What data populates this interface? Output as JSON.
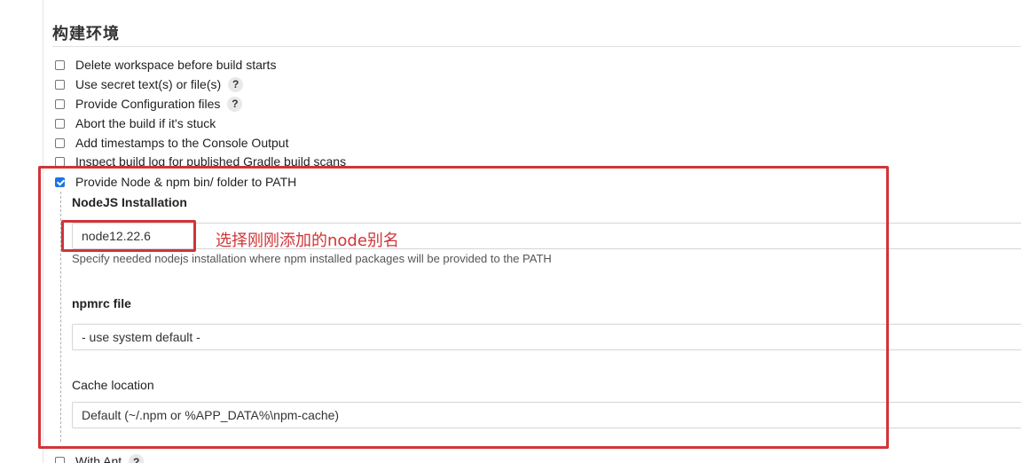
{
  "section": {
    "title": "构建环境"
  },
  "options": [
    {
      "label": "Delete workspace before build starts",
      "checked": false,
      "help": false
    },
    {
      "label": "Use secret text(s) or file(s)",
      "checked": false,
      "help": true
    },
    {
      "label": "Provide Configuration files",
      "checked": false,
      "help": true
    },
    {
      "label": "Abort the build if it's stuck",
      "checked": false,
      "help": false
    },
    {
      "label": "Add timestamps to the Console Output",
      "checked": false,
      "help": false
    },
    {
      "label": "Inspect build log for published Gradle build scans",
      "checked": false,
      "help": false
    },
    {
      "label": "Provide Node & npm bin/ folder to PATH",
      "checked": true,
      "help": false
    }
  ],
  "help_glyph": "?",
  "node": {
    "installation_label": "NodeJS Installation",
    "installation_value": "node12.22.6",
    "installation_hint": "Specify needed nodejs installation where npm installed packages will be provided to the PATH",
    "npmrc_label": "npmrc file",
    "npmrc_value": "- use system default -",
    "cache_label": "Cache location",
    "cache_value": "Default (~/.npm or %APP_DATA%\\npm-cache)"
  },
  "next_option": {
    "label": "With Ant",
    "checked": false,
    "help": true
  },
  "annotation": {
    "text": "选择刚刚添加的node别名",
    "color": "#d13438"
  }
}
